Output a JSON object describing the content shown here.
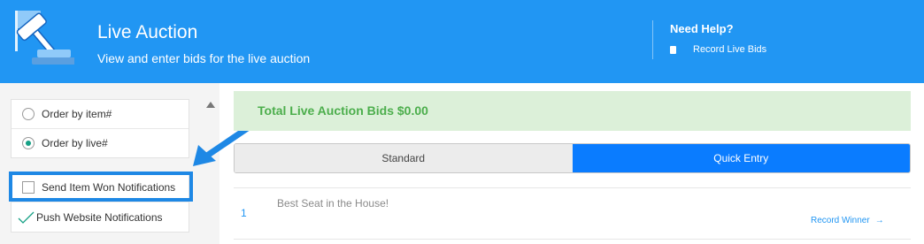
{
  "header": {
    "title": "Live Auction",
    "subtitle": "View and enter bids for the live auction",
    "icon": "gavel-icon",
    "help": {
      "title": "Need Help?",
      "link_label": "Record Live Bids",
      "link_icon": "book-icon"
    }
  },
  "sidebar": {
    "order_options": [
      {
        "label": "Order by item#",
        "checked": false
      },
      {
        "label": "Order by live#",
        "checked": true
      }
    ],
    "notification_options": [
      {
        "label": "Send Item Won Notifications",
        "checked": false
      },
      {
        "label": "Push Website Notifications",
        "checked": true
      }
    ]
  },
  "main": {
    "total_label": "Total Live Auction Bids $0.00",
    "tabs": [
      {
        "label": "Standard",
        "active": false
      },
      {
        "label": "Quick Entry",
        "active": true
      }
    ],
    "items": [
      {
        "number": "1",
        "name": "Best Seat in the House!",
        "action": "Record Winner"
      }
    ]
  },
  "colors": {
    "header_bg": "#2196f3",
    "accent": "#0a7cff",
    "success_bg": "#dcf0d9",
    "success_text": "#4cae4c",
    "radio_checked": "#16a085",
    "highlight": "#1e88e5"
  }
}
